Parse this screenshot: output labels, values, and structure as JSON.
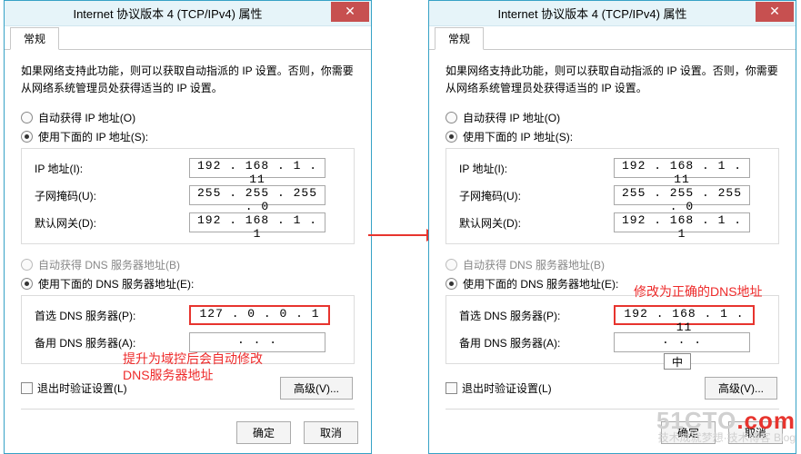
{
  "window_title": "Internet 协议版本 4 (TCP/IPv4) 属性",
  "tab_label": "常规",
  "desc": "如果网络支持此功能，则可以获取自动指派的 IP 设置。否则，你需要从网络系统管理员处获得适当的 IP 设置。",
  "radio_auto_ip": "自动获得 IP 地址(O)",
  "radio_manual_ip": "使用下面的 IP 地址(S):",
  "lbl_ip": "IP 地址(I):",
  "lbl_mask": "子网掩码(U):",
  "lbl_gw": "默认网关(D):",
  "radio_auto_dns": "自动获得 DNS 服务器地址(B)",
  "radio_manual_dns": "使用下面的 DNS 服务器地址(E):",
  "lbl_dns1": "首选 DNS 服务器(P):",
  "lbl_dns2": "备用 DNS 服务器(A):",
  "chk_validate": "退出时验证设置(L)",
  "btn_advanced": "高级(V)...",
  "btn_ok": "确定",
  "btn_cancel": "取消",
  "left": {
    "ip": "192 . 168 .  1  . 11",
    "mask": "255 . 255 . 255 .  0",
    "gw": "192 . 168 .  1  .  1",
    "dns1": "127 .  0  .  0  .  1",
    "dns2": " .     .     .  ",
    "note_line1": "提升为域控后会自动修改",
    "note_line2": "DNS服务器地址"
  },
  "right": {
    "ip": "192 . 168 .  1  . 11",
    "mask": "255 . 255 . 255 .  0",
    "gw": "192 . 168 .  1  .  1",
    "dns1": "192 . 168 .  1  . 11",
    "dns2": " .     .     .  ",
    "note": "修改为正确的DNS地址",
    "ime": "中"
  },
  "watermark_big": "51CTO",
  "watermark_dot": ".com",
  "watermark_small": "技术成就梦想·技术博客 Blog"
}
